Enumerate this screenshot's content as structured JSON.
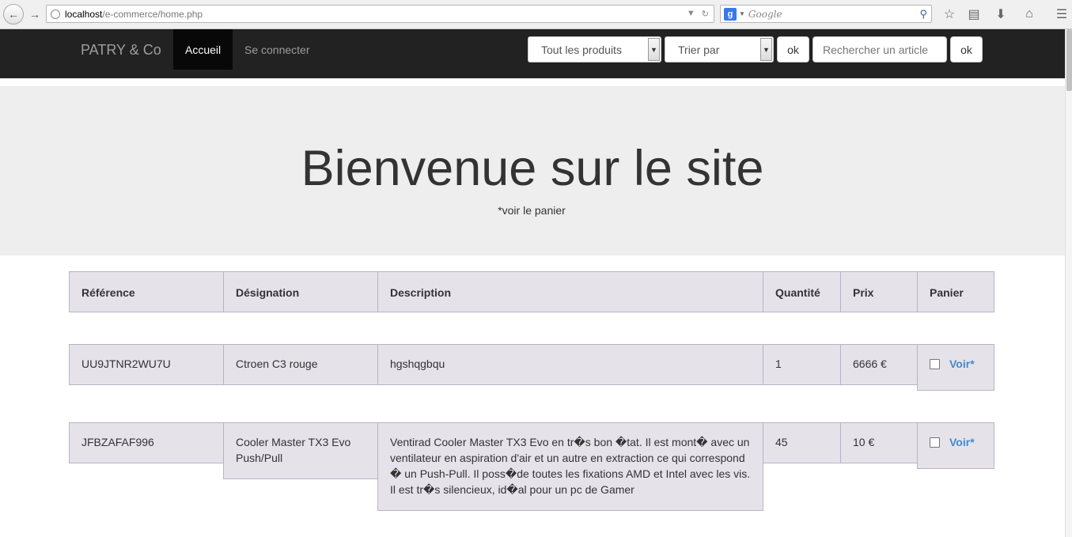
{
  "browser": {
    "url_host": "localhost",
    "url_path": "/e-commerce/home.php",
    "search_engine": "Google"
  },
  "navbar": {
    "brand": "PATRY & Co",
    "home": "Accueil",
    "login": "Se connecter",
    "category_select": "Tout les produits",
    "sort_select": "Trier par",
    "ok1": "ok",
    "search_placeholder": "Rechercher un article",
    "ok2": "ok"
  },
  "jumbotron": {
    "title": "Bienvenue sur le site",
    "subtitle": "*voir le panier"
  },
  "table": {
    "headers": [
      "Référence",
      "Désignation",
      "Description",
      "Quantité",
      "Prix",
      "Panier"
    ],
    "rows": [
      {
        "reference": "UU9JTNR2WU7U",
        "designation": "Ctroen C3 rouge",
        "description": "hgshqgbqu",
        "quantite": "1",
        "prix": "6666 €",
        "panier": "Voir*"
      },
      {
        "reference": "JFBZAFAF996",
        "designation": "Cooler Master TX3 Evo Push/Pull",
        "description": "Ventirad Cooler Master TX3 Evo en tr�s bon �tat. Il est mont� avec un ventilateur en aspiration d'air et un autre en extraction ce qui correspond � un Push-Pull. Il poss�de toutes les fixations AMD et Intel avec les vis. Il est tr�s silencieux, id�al pour un pc de Gamer",
        "quantite": "45",
        "prix": "10 €",
        "panier": "Voir*"
      }
    ]
  }
}
